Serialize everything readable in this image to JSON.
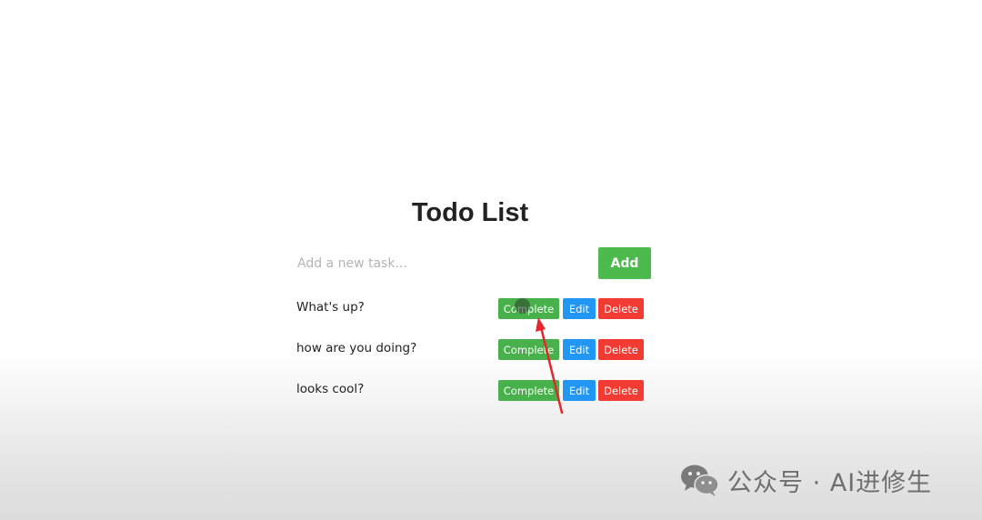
{
  "app": {
    "title": "Todo List",
    "input": {
      "placeholder": "Add a new task...",
      "value": ""
    },
    "add_label": "Add",
    "tasks": [
      {
        "text": "What's up?",
        "complete_label": "Complete",
        "edit_label": "Edit",
        "delete_label": "Delete"
      },
      {
        "text": "how are you doing?",
        "complete_label": "Complete",
        "edit_label": "Edit",
        "delete_label": "Delete"
      },
      {
        "text": "looks cool?",
        "complete_label": "Complete",
        "edit_label": "Edit",
        "delete_label": "Delete"
      }
    ]
  },
  "watermark": {
    "icon": "wechat-icon",
    "text": "公众号 · AI进修生"
  },
  "colors": {
    "add": "#4cba4d",
    "complete": "#49b14b",
    "edit": "#2196f3",
    "delete": "#f23b32",
    "annotation_arrow": "#e5262b"
  }
}
